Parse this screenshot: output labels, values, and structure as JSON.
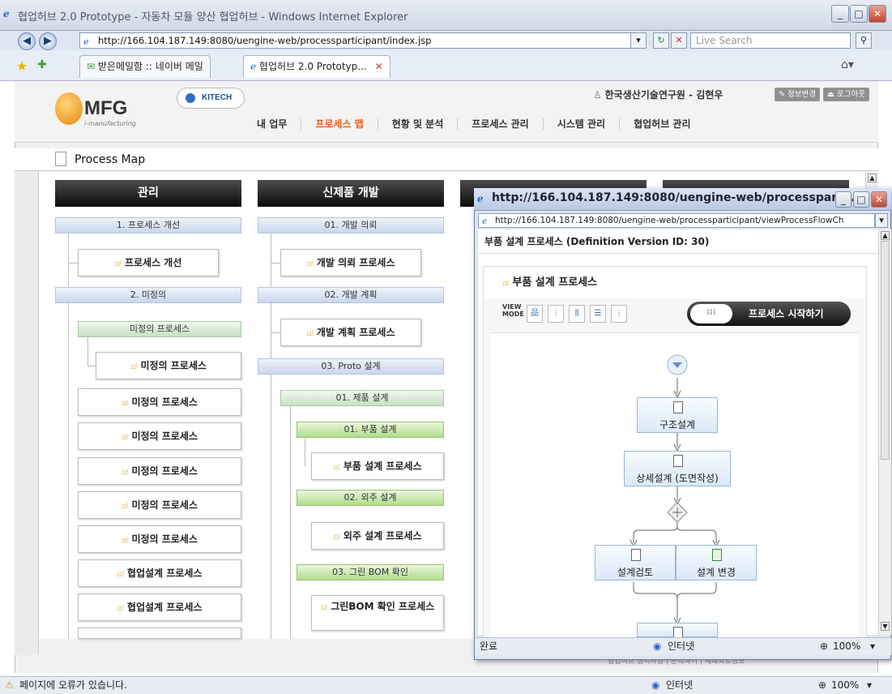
{
  "browser": {
    "title": "협업허브 2.0 Prototype - 자동차 모듈 양산 협업허브 - Windows Internet Explorer",
    "url": "http://166.104.187.149:8080/uengine-web/processparticipant/index.jsp",
    "search_placeholder": "Live Search",
    "tabs": [
      {
        "label": "받은메일함 :: 네이버 메일"
      },
      {
        "label": "협업허브 2.0 Prototyp..."
      }
    ],
    "status_error": "페이지에 오류가 있습니다.",
    "status_zone": "인터넷",
    "status_zoom": "100%"
  },
  "header": {
    "logo_text": "MFG",
    "logo_sub": "i-manufacturing",
    "partner": "KITECH",
    "user": "한국생산기술연구원 - 김현우",
    "btn_profile": "정보변경",
    "btn_logout": "로그아웃"
  },
  "menu": [
    "내 업무",
    "프로세스 맵",
    "현황 및 분석",
    "프로세스 관리",
    "시스템 관리",
    "협업허브 관리"
  ],
  "page": {
    "title": "Process Map"
  },
  "col1": {
    "title": "관리",
    "cat1": "1. 프로세스 개선",
    "proc1": "프로세스 개선",
    "cat2": "2. 미정의",
    "sub": "미정의 프로세스",
    "proc_undef": "미정의 프로세스",
    "proc_collab": "협업설계 프로세스"
  },
  "col2": {
    "title": "신제품 개발",
    "cat1": "01. 개발 의뢰",
    "proc1": "개발 의뢰 프로세스",
    "cat2": "02. 개발 계획",
    "proc2": "개발 계획 프로세스",
    "cat3": "03. Proto 설계",
    "sub1": "01. 제품 설계",
    "sub1a": "01. 부품 설계",
    "proc3": "부품 설계 프로세스",
    "sub1b": "02. 외주 설계",
    "proc4": "외주 설계 프로세스",
    "sub1c": "03. 그린 BOM 확인",
    "proc5": "그린BOM 확인 프로세스"
  },
  "popup": {
    "title": "http://166.104.187.149:8080/uengine-web/processparti...",
    "url": "http://166.104.187.149:8080/uengine-web/processparticipant/viewProcessFlowCh",
    "header": "부품 설계 프로세스 (Definition Version ID: 30)",
    "inner_title": "부품 설계 프로세스",
    "view_mode": "VIEW MODE",
    "start_label": "프로세스 시작하기",
    "nodes": [
      "구조설계",
      "상세설계 (도면작성)",
      "설계검토",
      "설계 변경"
    ],
    "status_done": "완료",
    "status_zone": "인터넷",
    "status_zoom": "100%"
  },
  "footer": {
    "links": "협업허브 정지사항 | 문의하기 | 폐쇄회로정보"
  }
}
